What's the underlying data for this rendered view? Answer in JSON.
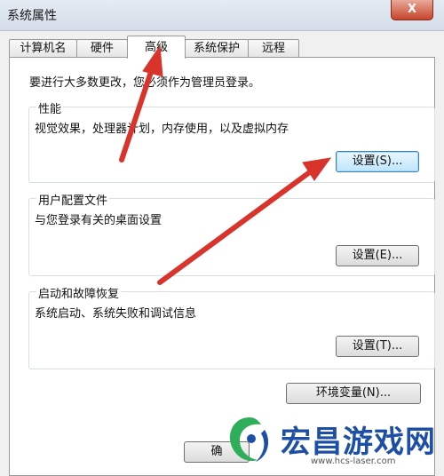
{
  "window": {
    "title": "系统属性",
    "close_label": "X"
  },
  "tabs": [
    {
      "label": "计算机名",
      "active": false
    },
    {
      "label": "硬件",
      "active": false
    },
    {
      "label": "高级",
      "active": true
    },
    {
      "label": "系统保护",
      "active": false
    },
    {
      "label": "远程",
      "active": false
    }
  ],
  "advanced": {
    "admin_notice": "要进行大多数更改，您必须作为管理员登录。",
    "performance": {
      "title": "性能",
      "description": "视觉效果，处理器计划，内存使用，以及虚拟内存",
      "button": "设置(S)..."
    },
    "user_profiles": {
      "title": "用户配置文件",
      "description": "与您登录有关的桌面设置",
      "button": "设置(E)..."
    },
    "startup_recovery": {
      "title": "启动和故障恢复",
      "description": "系统启动、系统失败和调试信息",
      "button": "设置(T)..."
    },
    "env_button": "环境变量(N)..."
  },
  "footer": {
    "ok_label": "确"
  },
  "watermark": {
    "name": "宏昌游戏网",
    "url": "www.hcs-laser.com"
  },
  "colors": {
    "arrow": "#d8342c",
    "focus_border": "#3c7fb1",
    "watermark_blue": "#1e4fa6",
    "watermark_green": "#2fae5a"
  }
}
